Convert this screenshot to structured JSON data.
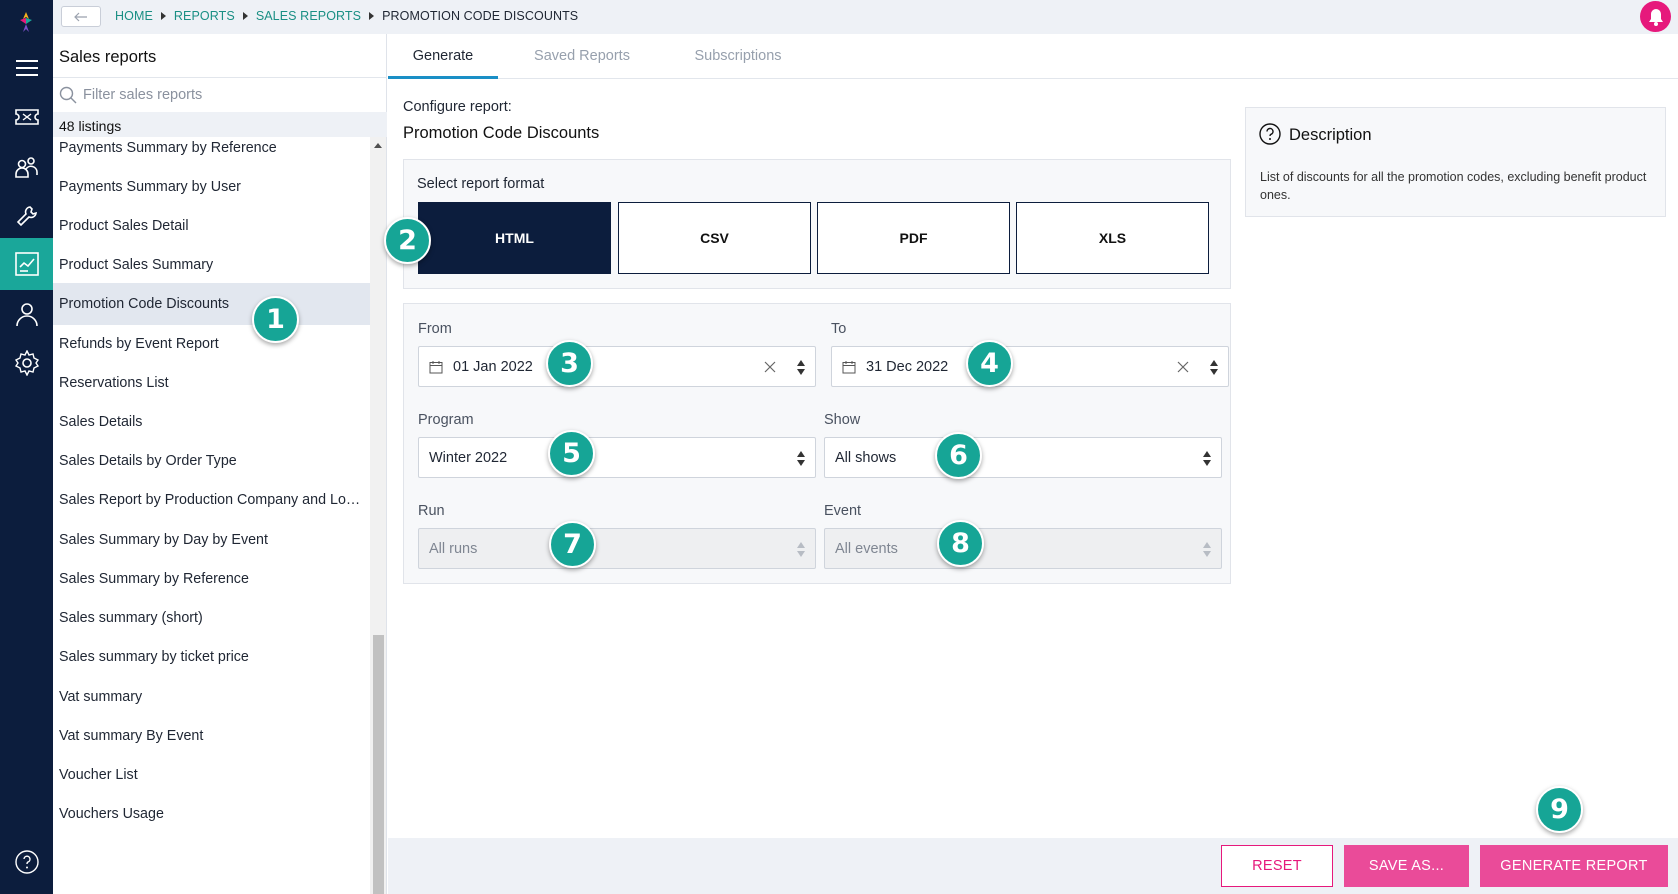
{
  "nav_rail": {
    "items": [
      "menu-icon",
      "ticket-icon",
      "people-icon",
      "wrench-icon",
      "report-icon",
      "user-icon",
      "settings-icon",
      "help-icon"
    ],
    "active": "report-icon"
  },
  "breadcrumb": {
    "items": [
      "HOME",
      "REPORTS",
      "SALES REPORTS"
    ],
    "current": "PROMOTION CODE DISCOUNTS"
  },
  "report_list": {
    "title": "Sales reports",
    "filter_placeholder": "Filter sales reports",
    "count": "48 listings",
    "items": [
      "Payments Summary by Reference",
      "Payments Summary by User",
      "Product Sales Detail",
      "Product Sales Summary",
      "Promotion Code Discounts",
      "Refunds by Event Report",
      "Reservations List",
      "Sales Details",
      "Sales Details by Order Type",
      "Sales Report by Production Company and Location",
      "Sales Summary by Day by Event",
      "Sales Summary by Reference",
      "Sales summary (short)",
      "Sales summary by ticket price",
      "Vat summary",
      "Vat summary By Event",
      "Voucher List",
      "Vouchers Usage"
    ],
    "selected": "Promotion Code Discounts"
  },
  "tabs": [
    {
      "label": "Generate",
      "active": true
    },
    {
      "label": "Saved Reports",
      "active": false
    },
    {
      "label": "Subscriptions",
      "active": false
    }
  ],
  "config": {
    "label": "Configure report:",
    "report_name": "Promotion Code Discounts",
    "format_label": "Select report format",
    "formats": [
      "HTML",
      "CSV",
      "PDF",
      "XLS"
    ],
    "selected_format": "HTML"
  },
  "filters": {
    "from": {
      "label": "From",
      "value": "01 Jan 2022"
    },
    "to": {
      "label": "To",
      "value": "31 Dec 2022"
    },
    "program": {
      "label": "Program",
      "value": "Winter 2022"
    },
    "show": {
      "label": "Show",
      "value": "All shows"
    },
    "run": {
      "label": "Run",
      "value": "All runs",
      "disabled": true
    },
    "event": {
      "label": "Event",
      "value": "All events",
      "disabled": true
    }
  },
  "description": {
    "title": "Description",
    "text": "List of discounts for all the promotion codes, excluding benefit product ones."
  },
  "actions": {
    "reset": "RESET",
    "save_as": "SAVE AS...",
    "generate": "GENERATE REPORT"
  },
  "annotations": [
    "1",
    "2",
    "3",
    "4",
    "5",
    "6",
    "7",
    "8",
    "9"
  ],
  "colors": {
    "nav_bg": "#0c1d3d",
    "accent_teal": "#1aa79a",
    "link_teal": "#1a8f84",
    "primary_pink": "#ea4b99",
    "selected_format_bg": "#0c1d3d",
    "badge": "#16a596"
  }
}
